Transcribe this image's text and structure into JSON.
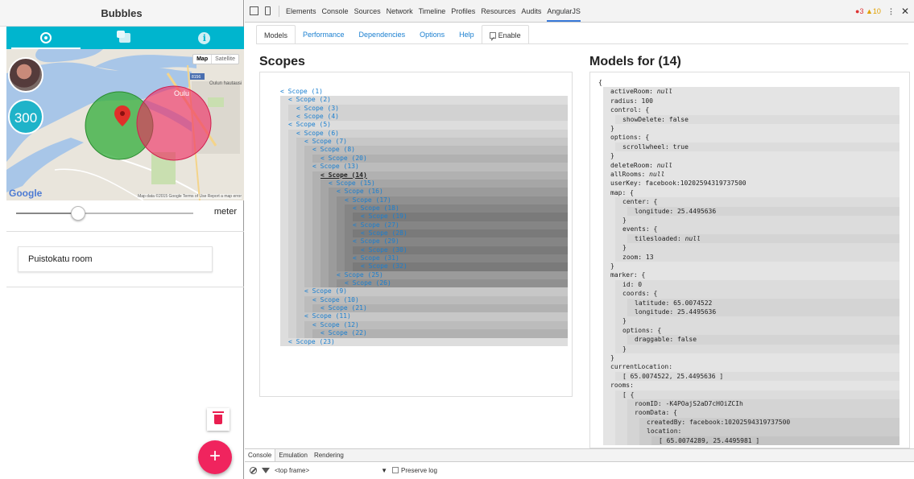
{
  "app": {
    "title": "Bubbles",
    "tabs": [
      {
        "icon": "radio-icon",
        "active": true
      },
      {
        "icon": "chat-icon",
        "active": false
      },
      {
        "icon": "info-icon",
        "active": false
      }
    ],
    "accent_color": "#00b5ce",
    "map": {
      "toggle_map": "Map",
      "toggle_satellite": "Satellite",
      "user_count": "300",
      "google_label": "Google",
      "credits": "Map data ©2015 Google   Terms of Use   Report a map error",
      "places": [
        "Oulun hautausi",
        "Oulu",
        "8156"
      ]
    },
    "slider": {
      "unit": "meter",
      "value_fraction": 0.35
    },
    "room_name": "Puistokatu room",
    "fab_label": "+"
  },
  "devtools": {
    "panels": [
      "Elements",
      "Console",
      "Sources",
      "Network",
      "Timeline",
      "Profiles",
      "Resources",
      "Audits",
      "AngularJS"
    ],
    "active_panel": "AngularJS",
    "errors": "3",
    "warnings": "10",
    "angular_tabs": [
      "Models",
      "Performance",
      "Dependencies",
      "Options",
      "Help"
    ],
    "enable_label": "Enable",
    "scopes_title": "Scopes",
    "models_title": "Models for (14)",
    "scopes": [
      {
        "label": "< Scope (1)",
        "depth": 0
      },
      {
        "label": "< Scope (2)",
        "depth": 1
      },
      {
        "label": "< Scope (3)",
        "depth": 2
      },
      {
        "label": "< Scope (4)",
        "depth": 2
      },
      {
        "label": "< Scope (5)",
        "depth": 1
      },
      {
        "label": "< Scope (6)",
        "depth": 2
      },
      {
        "label": "< Scope (7)",
        "depth": 3
      },
      {
        "label": "< Scope (8)",
        "depth": 4
      },
      {
        "label": "< Scope (20)",
        "depth": 5
      },
      {
        "label": "< Scope (13)",
        "depth": 4
      },
      {
        "label": "< Scope (14)",
        "depth": 5,
        "selected": true
      },
      {
        "label": "< Scope (15)",
        "depth": 6
      },
      {
        "label": "< Scope (16)",
        "depth": 7
      },
      {
        "label": "< Scope (17)",
        "depth": 8
      },
      {
        "label": "< Scope (18)",
        "depth": 9
      },
      {
        "label": "< Scope (19)",
        "depth": 10
      },
      {
        "label": "< Scope (27)",
        "depth": 9
      },
      {
        "label": "< Scope (28)",
        "depth": 10
      },
      {
        "label": "< Scope (29)",
        "depth": 9
      },
      {
        "label": "< Scope (30)",
        "depth": 10
      },
      {
        "label": "< Scope (31)",
        "depth": 9
      },
      {
        "label": "< Scope (32)",
        "depth": 10
      },
      {
        "label": "< Scope (25)",
        "depth": 7
      },
      {
        "label": "< Scope (26)",
        "depth": 8
      },
      {
        "label": "< Scope (9)",
        "depth": 3
      },
      {
        "label": "< Scope (10)",
        "depth": 4
      },
      {
        "label": "< Scope (21)",
        "depth": 5
      },
      {
        "label": "< Scope (11)",
        "depth": 3
      },
      {
        "label": "< Scope (12)",
        "depth": 4
      },
      {
        "label": "< Scope (22)",
        "depth": 5
      },
      {
        "label": "< Scope (23)",
        "depth": 1
      }
    ],
    "models": [
      {
        "text": "{",
        "depth": 0
      },
      {
        "text": "activeRoom: ",
        "italic": "null",
        "depth": 1
      },
      {
        "text": "radius: 100",
        "depth": 1
      },
      {
        "text": "control:  {",
        "depth": 1
      },
      {
        "text": "showDelete: false",
        "depth": 2
      },
      {
        "text": "}",
        "depth": 1
      },
      {
        "text": "options:  {",
        "depth": 1
      },
      {
        "text": "scrollwheel: true",
        "depth": 2
      },
      {
        "text": "}",
        "depth": 1
      },
      {
        "text": "deleteRoom: ",
        "italic": "null",
        "depth": 1
      },
      {
        "text": "allRooms: ",
        "italic": "null",
        "depth": 1
      },
      {
        "text": "userKey: facebook:10202594319737500",
        "depth": 1
      },
      {
        "text": "map:  {",
        "depth": 1
      },
      {
        "text": "center:  {",
        "depth": 2
      },
      {
        "text": "longitude: 25.4495636",
        "depth": 3
      },
      {
        "text": "}",
        "depth": 2
      },
      {
        "text": "events:  {",
        "depth": 2
      },
      {
        "text": "tilesloaded: ",
        "italic": "null",
        "depth": 3
      },
      {
        "text": "}",
        "depth": 2
      },
      {
        "text": "zoom: 13",
        "depth": 2
      },
      {
        "text": "}",
        "depth": 1
      },
      {
        "text": "marker:  {",
        "depth": 1
      },
      {
        "text": "id: 0",
        "depth": 2
      },
      {
        "text": "coords:  {",
        "depth": 2
      },
      {
        "text": "latitude: 65.0074522",
        "depth": 3
      },
      {
        "text": "longitude: 25.4495636",
        "depth": 3
      },
      {
        "text": "}",
        "depth": 2
      },
      {
        "text": "options:  {",
        "depth": 2
      },
      {
        "text": "draggable: false",
        "depth": 3
      },
      {
        "text": "}",
        "depth": 2
      },
      {
        "text": "}",
        "depth": 1
      },
      {
        "text": "currentLocation:",
        "depth": 1
      },
      {
        "text": "[ 65.0074522, 25.4495636 ]",
        "depth": 2
      },
      {
        "text": "rooms:",
        "depth": 1
      },
      {
        "text": "[  {",
        "depth": 2
      },
      {
        "text": "roomID: -K4POajS2aD7cHOiZCIh",
        "depth": 3
      },
      {
        "text": "roomData:  {",
        "depth": 3
      },
      {
        "text": "createdBy: facebook:10202594319737500",
        "depth": 4
      },
      {
        "text": "location:",
        "depth": 4
      },
      {
        "text": "[ 65.0074289, 25.4495981 ]",
        "depth": 5
      }
    ],
    "drawer_tabs": [
      "Console",
      "Emulation",
      "Rendering"
    ],
    "frame_select": "<top frame>",
    "preserve_log": "Preserve log"
  }
}
